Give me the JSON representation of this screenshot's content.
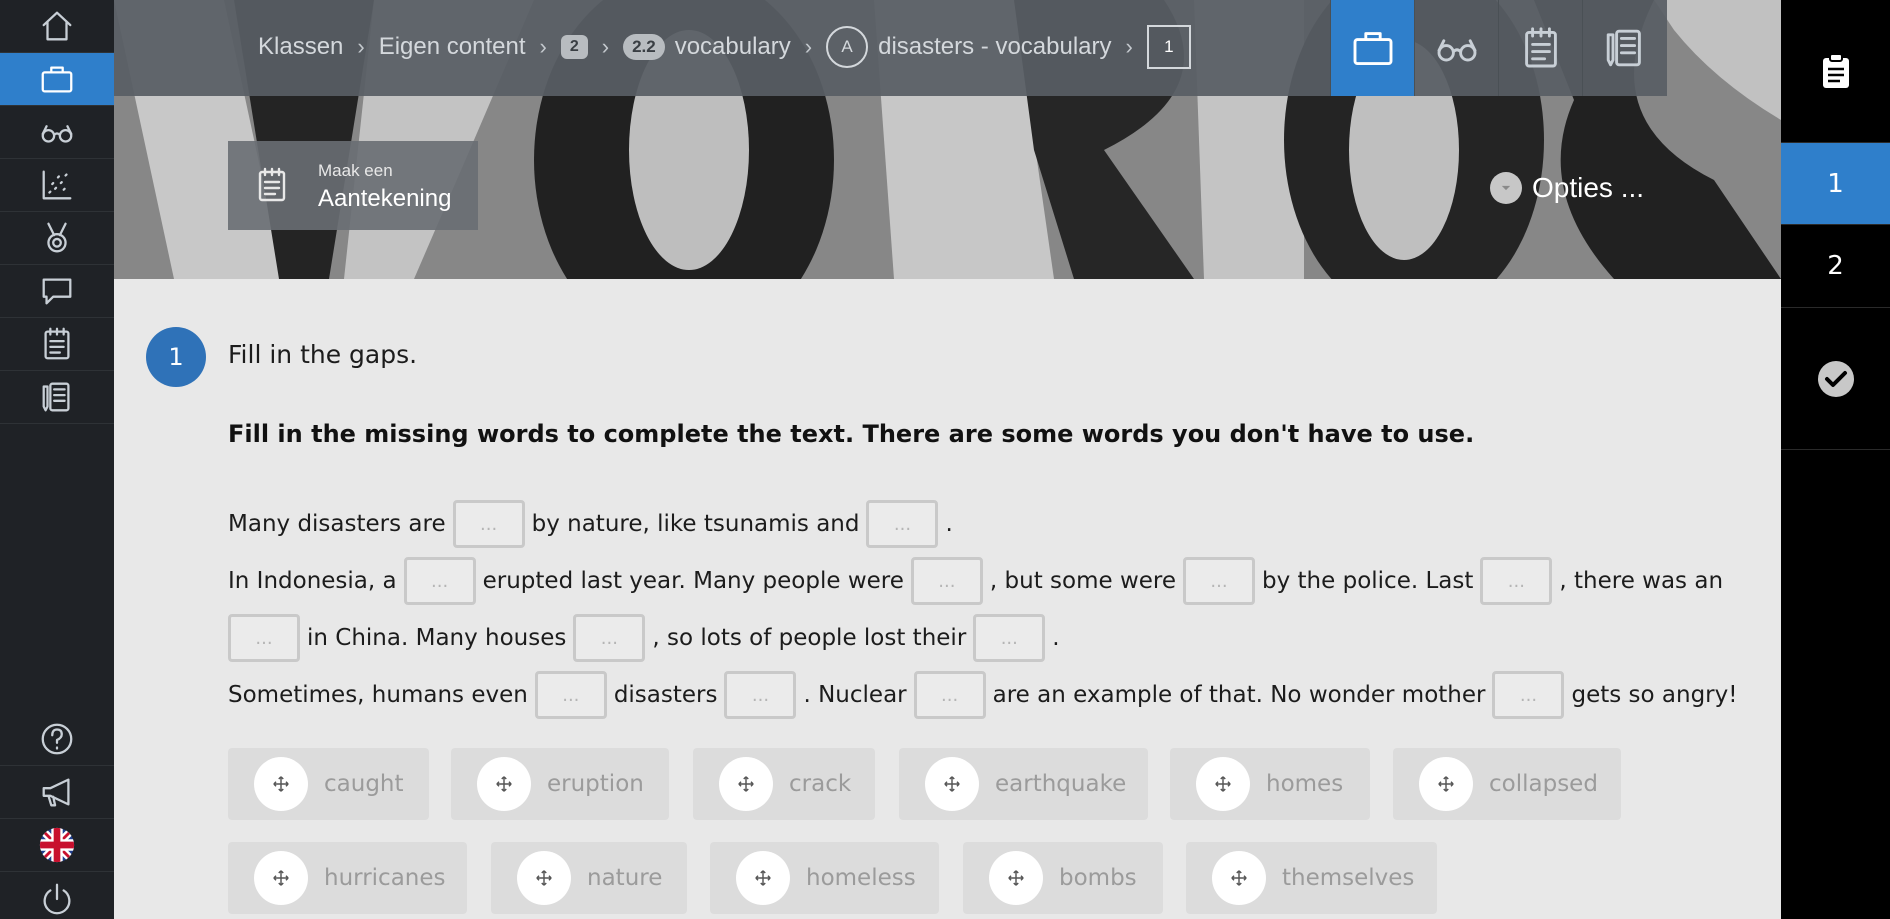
{
  "breadcrumb": {
    "item1": "Klassen",
    "item2": "Eigen content",
    "badge1": "2",
    "badge2": "2.2",
    "item3": "vocabulary",
    "circle": "A",
    "item4": "disasters - vocabulary",
    "box": "1"
  },
  "note": {
    "small": "Maak een",
    "big": "Aantekening"
  },
  "options": {
    "label": "Opties ..."
  },
  "question": {
    "number": "1",
    "title": "Fill in the gaps.",
    "instruction": "Fill in the missing words to complete the text. There are some words you don't have to use."
  },
  "gap_placeholder": "...",
  "text": {
    "l1a": "Many disasters are",
    "l1b": "by nature, like tsunamis and",
    "l1c": ".",
    "l2a": "In Indonesia, a",
    "l2b": "erupted last year. Many people were",
    "l2c": ", but some were",
    "l2d": "by the police. Last",
    "l2e": ", there was an",
    "l3a": "in China. Many houses",
    "l3b": ", so lots of people lost their",
    "l3c": ".",
    "l4a": "Sometimes, humans even",
    "l4b": "disasters",
    "l4c": ". Nuclear",
    "l4d": "are an example of that. No wonder mother",
    "l4e": "gets so angry!"
  },
  "words": [
    "caught",
    "eruption",
    "crack",
    "earthquake",
    "homes",
    "collapsed",
    "hurricanes",
    "nature",
    "homeless",
    "bombs",
    "themselves"
  ],
  "right_panel": {
    "item1": "1",
    "item2": "2"
  },
  "colors": {
    "accent": "#2f7fcb",
    "sidebar": "#1f2226",
    "content_bg": "#e8e8e8"
  },
  "sidebar_icons": [
    "home-icon",
    "briefcase-icon",
    "glasses-icon",
    "chart-icon",
    "medal-icon",
    "chat-icon",
    "notepad-icon",
    "notebook-pencil-icon",
    "help-icon",
    "megaphone-icon",
    "uk-flag-icon",
    "power-icon"
  ]
}
